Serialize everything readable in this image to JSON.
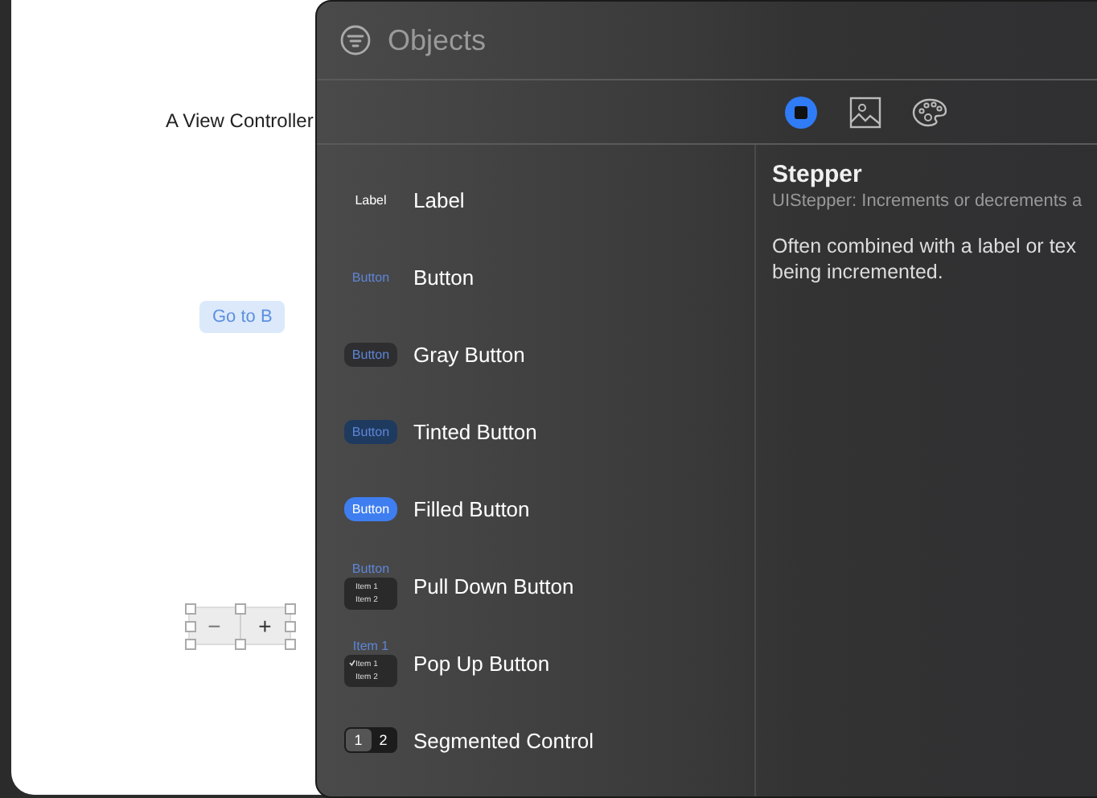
{
  "canvas": {
    "scene_title": "A View Controller",
    "button": "Go to B",
    "stepper": {
      "minus": "−",
      "plus": "+",
      "selected": true
    }
  },
  "library": {
    "search": {
      "placeholder": "Objects"
    },
    "tabs": [
      {
        "kind": "objects",
        "selected": true
      },
      {
        "kind": "media",
        "selected": false
      },
      {
        "kind": "colors",
        "selected": false
      }
    ],
    "items": [
      {
        "kind": "label",
        "name": "Label",
        "preview": "Label"
      },
      {
        "kind": "plain",
        "name": "Button",
        "preview": "Button"
      },
      {
        "kind": "gray",
        "name": "Gray Button",
        "preview": "Button"
      },
      {
        "kind": "tinted",
        "name": "Tinted Button",
        "preview": "Button"
      },
      {
        "kind": "filled",
        "name": "Filled Button",
        "preview": "Button"
      },
      {
        "kind": "pulldown",
        "name": "Pull Down Button",
        "preview": "Button",
        "menu": [
          {
            "label": "Item 1",
            "checked": false
          },
          {
            "label": "Item 2",
            "checked": false
          }
        ]
      },
      {
        "kind": "popup",
        "name": "Pop Up Button",
        "preview": "Item 1",
        "menu": [
          {
            "label": "Item 1",
            "checked": true
          },
          {
            "label": "Item 2",
            "checked": false
          }
        ]
      },
      {
        "kind": "segmented",
        "name": "Segmented Control",
        "segments": [
          {
            "label": "1",
            "selected": true
          },
          {
            "label": "2",
            "selected": false
          }
        ]
      }
    ],
    "detail": {
      "title": "Stepper",
      "subtitle": "UIStepper: Increments or decrements a",
      "description": [
        "Often combined with a label or tex",
        "being incremented."
      ]
    }
  }
}
